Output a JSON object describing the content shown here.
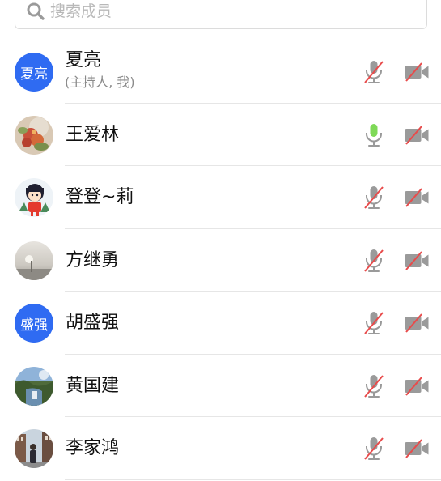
{
  "search": {
    "placeholder": "搜索成员",
    "icon": "search-icon"
  },
  "colors": {
    "avatar_blue": "#2f6bf2",
    "muted_icon_gray": "#9a9a9a",
    "mute_slash_red": "#e84b4b",
    "mic_active_green": "#7ed957"
  },
  "members": [
    {
      "name": "夏亮",
      "subtitle": "(主持人, 我)",
      "avatar_text": "夏亮",
      "avatar_type": "text",
      "mic": "muted",
      "camera": "off"
    },
    {
      "name": "王爱林",
      "avatar_type": "photo-flowers",
      "mic": "active",
      "camera": "off"
    },
    {
      "name": "登登~莉",
      "avatar_type": "cartoon-girl",
      "mic": "muted",
      "camera": "off"
    },
    {
      "name": "方继勇",
      "avatar_type": "photo-haze",
      "mic": "muted",
      "camera": "off"
    },
    {
      "name": "胡盛强",
      "avatar_text": "盛强",
      "avatar_type": "text",
      "mic": "muted",
      "camera": "off"
    },
    {
      "name": "黄国建",
      "avatar_type": "photo-landscape",
      "mic": "muted",
      "camera": "off"
    },
    {
      "name": "李家鸿",
      "avatar_type": "photo-street",
      "mic": "muted",
      "camera": "off"
    }
  ]
}
